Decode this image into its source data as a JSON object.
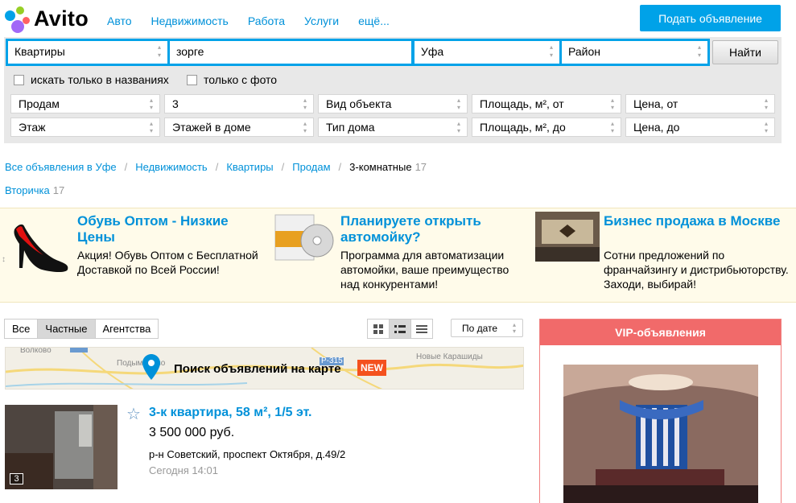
{
  "header": {
    "logo_text": "Avito",
    "nav": [
      "Авто",
      "Недвижимость",
      "Работа",
      "Услуги",
      "ещё..."
    ],
    "post_button": "Подать объявление"
  },
  "search": {
    "category": "Квартиры",
    "query": "зорге",
    "city": "Уфа",
    "district": "Район",
    "find_button": "Найти",
    "title_only": "искать только в названиях",
    "with_photo": "только с фото"
  },
  "filters": {
    "row1": [
      "Продам",
      "3",
      "Вид объекта",
      "Площадь, м², от",
      "Цена, от"
    ],
    "row2": [
      "Этаж",
      "Этажей в доме",
      "Тип дома",
      "Площадь, м², до",
      "Цена, до"
    ]
  },
  "breadcrumbs": {
    "items": [
      "Все объявления в Уфе",
      "Недвижимость",
      "Квартиры",
      "Продам"
    ],
    "current": "3-комнатные",
    "current_count": "17",
    "sub": "Вторичка",
    "sub_count": "17"
  },
  "ads": [
    {
      "title": "Обувь Оптом - Низкие Цены",
      "text": "Акция! Обувь Оптом с Бесплатной Доставкой по Всей России!"
    },
    {
      "title": "Планируете открыть автомойку?",
      "text": "Программа для автоматизации автомойки, ваше преимущество над конкурентами!"
    },
    {
      "title": "Бизнес продажа в Москве",
      "text": "Сотни предложений по франчайзингу и дистрибьюторству. Заходи, выбирай!"
    }
  ],
  "tabs": [
    "Все",
    "Частные",
    "Агентства"
  ],
  "sort": "По дате",
  "map": {
    "label": "Поиск объявлений на карте",
    "badge": "NEW",
    "places": [
      "Волково",
      "Подымалово",
      "Новые Карашиды",
      "Р-315"
    ]
  },
  "listing": {
    "title": "3-к квартира, 58 м², 1/5 эт.",
    "price": "3 500 000 руб.",
    "address": "р-н Советский, проспект Октября, д.49/2",
    "date": "Сегодня 14:01",
    "photo_count": "3"
  },
  "vip": {
    "header": "VIP-объявления"
  },
  "colors": {
    "accent": "#00a2e8",
    "link": "#0091d9",
    "vip": "#f16a6a",
    "badge": "#f4511e"
  }
}
